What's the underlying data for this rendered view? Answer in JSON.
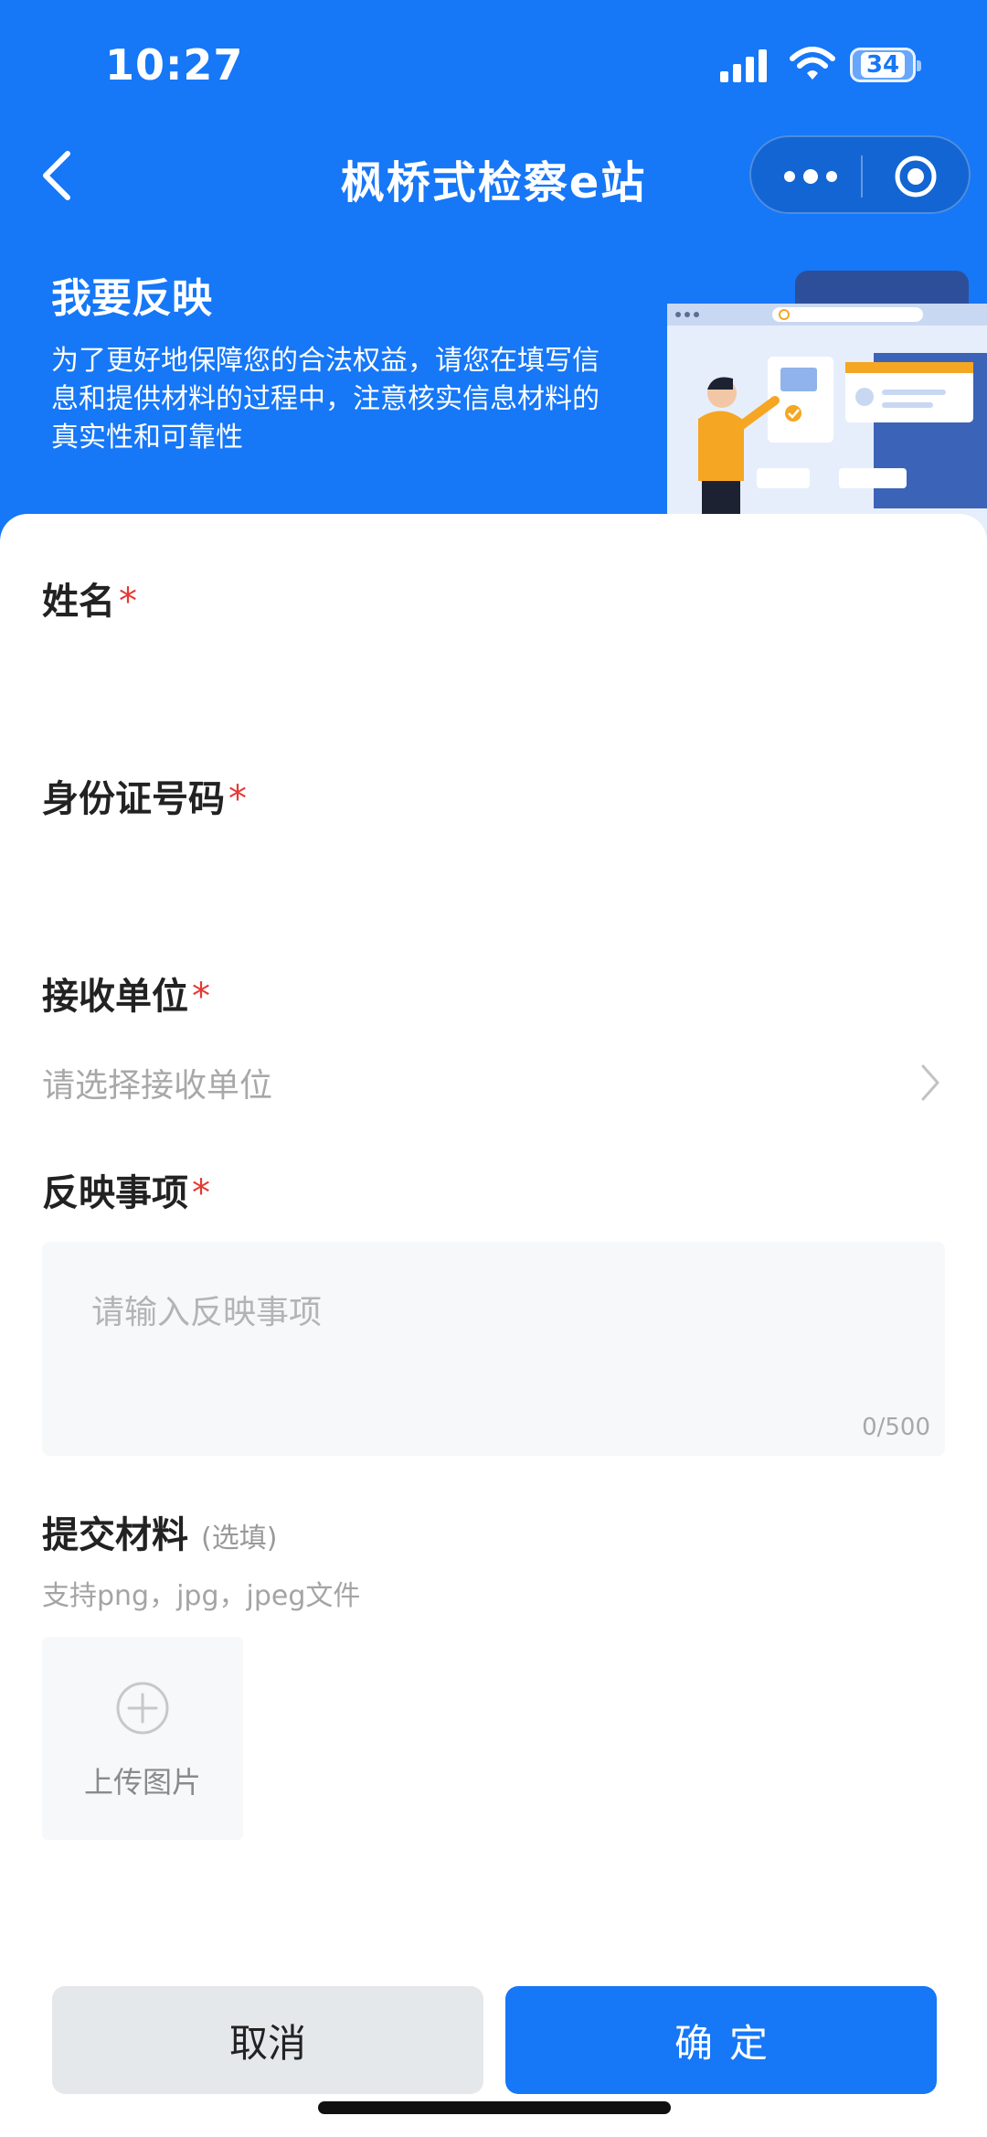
{
  "status_bar": {
    "time": "10:27",
    "battery": "34",
    "icons": [
      "signal-icon",
      "wifi-icon",
      "battery-icon"
    ]
  },
  "nav": {
    "title": "枫桥式检察e站",
    "icons": [
      "back-icon",
      "more-icon",
      "close-target-icon"
    ]
  },
  "intro": {
    "title": "我要反映",
    "description": "为了更好地保障您的合法权益，请您在填写信息和提供材料的过程中，注意核实信息材料的真实性和可靠性"
  },
  "form": {
    "name": {
      "label": "姓名",
      "required_mark": "*",
      "value": ""
    },
    "id_number": {
      "label": "身份证号码",
      "required_mark": "*",
      "value": ""
    },
    "receiver": {
      "label": "接收单位",
      "required_mark": "*",
      "placeholder": "请选择接收单位"
    },
    "matter": {
      "label": "反映事项",
      "required_mark": "*",
      "placeholder": "请输入反映事项",
      "counter": "0/500"
    },
    "materials": {
      "label": "提交材料",
      "optional": "(选填)",
      "hint": "支持png，jpg，jpeg文件",
      "upload_label": "上传图片"
    }
  },
  "actions": {
    "cancel": "取消",
    "confirm": "确定"
  },
  "colors": {
    "primary": "#1677f7",
    "required": "#e53935",
    "cancel_bg": "#e5e8eb"
  }
}
